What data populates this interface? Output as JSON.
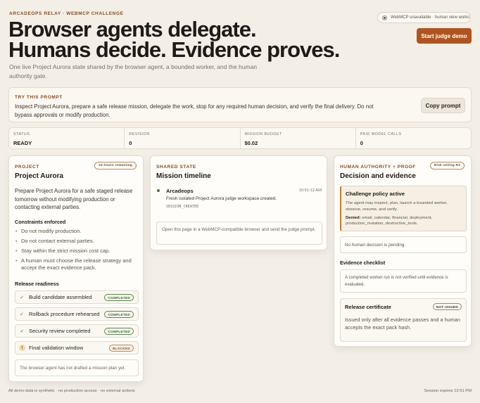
{
  "header": {
    "eyebrow": "ARCADEOPS RELAY · WEBMCP CHALLENGE",
    "status_pill": "WebMCP unavailable · human view works",
    "start_button": "Start judge demo",
    "headline_line1": "Browser agents delegate.",
    "headline_line2": "Humans decide. Evidence proves.",
    "lead": "One live Project Aurora state shared by the browser agent, a bounded worker, and the human authority gate."
  },
  "prompt": {
    "label": "TRY THIS PROMPT",
    "text": "Inspect Project Aurora, prepare a safe release mission, delegate the work, stop for any required human decision, and verify the final delivery. Do not bypass approvals or modify production.",
    "copy_button": "Copy prompt"
  },
  "stats": [
    {
      "label": "STATUS",
      "value": "READY"
    },
    {
      "label": "REVISION",
      "value": "0"
    },
    {
      "label": "MISSION BUDGET",
      "value": "$0.02"
    },
    {
      "label": "PAID MODEL CALLS",
      "value": "0"
    }
  ],
  "project": {
    "kicker": "PROJECT",
    "title": "Project Aurora",
    "tag": "24 hours remaining",
    "description": "Prepare Project Aurora for a safe staged release tomorrow without modifying production or contacting external parties.",
    "constraints_heading": "Constraints enforced",
    "constraints": [
      "Do not modify production.",
      "Do not contact external parties.",
      "Stay within the strict mission cost cap.",
      "A human must choose the release strategy and accept the exact evidence pack."
    ],
    "readiness_heading": "Release readiness",
    "readiness": [
      {
        "label": "Build candidate assembled",
        "status": "COMPLETED",
        "icon": "check-icon"
      },
      {
        "label": "Rollback procedure rehearsed",
        "status": "COMPLETED",
        "icon": "check-icon"
      },
      {
        "label": "Security review completed",
        "status": "COMPLETED",
        "icon": "check-icon"
      },
      {
        "label": "Final validation window",
        "status": "BLOCKED",
        "icon": "warning-icon"
      }
    ],
    "plan_note": "The browser agent has not drafted a mission plan yet."
  },
  "timeline": {
    "kicker": "SHARED STATE",
    "title": "Mission timeline",
    "entry": {
      "name": "Arcadeops",
      "time": "10:51:12 AM",
      "message": "Fresh isolated Project Aurora judge workspace created.",
      "code": "SESSION_CREATED"
    },
    "note": "Open this page in a WebMCP-compatible browser and send the judge prompt."
  },
  "authority": {
    "kicker": "HUMAN AUTHORITY + PROOF",
    "title": "Decision and evidence",
    "tag": "Risk ceiling R3",
    "policy_heading": "Challenge policy active",
    "policy_text": "The agent may inspect, plan, launch a bounded worker, observe, resume, and verify.",
    "denied_label": "Denied:",
    "denied_text": "email, calendar, financial, deployment, production_mutation, destructive_tools.",
    "decision_note": "No human decision is pending.",
    "evidence_heading": "Evidence checklist",
    "evidence_note": "A completed worker run is not verified until evidence is evaluated.",
    "cert_heading": "Release certificate",
    "cert_badge": "NOT ISSUED",
    "cert_text": "Issued only after all evidence passes and a human accepts the exact pack hash."
  },
  "footer": {
    "left": "All demo data is synthetic · no production access · no external actions",
    "right": "Session expires 12:51 PM"
  },
  "colors": {
    "accent": "#b0541f",
    "background": "#f3eee6",
    "success": "#4f7a3a"
  }
}
